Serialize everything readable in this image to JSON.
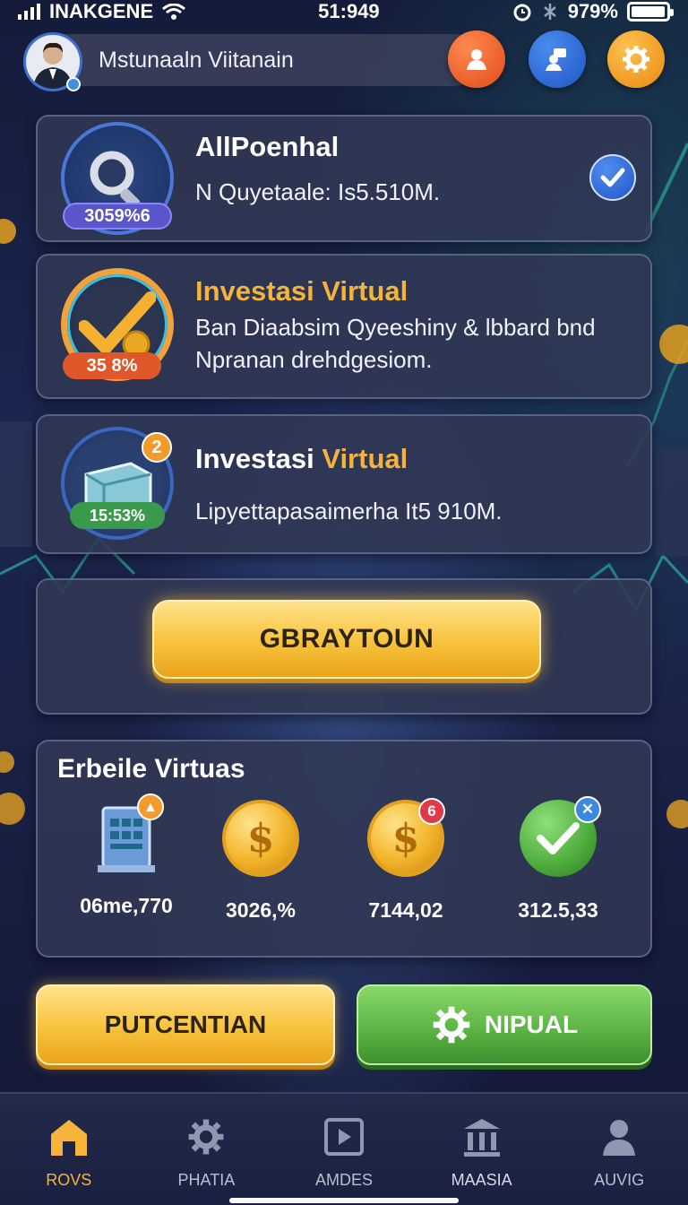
{
  "status_bar": {
    "carrier": "INAKGENE",
    "time": "51:949",
    "battery": "979%",
    "battery_level": 0.97
  },
  "header": {
    "user_name": "Mstunaaln Viitanain",
    "icons": [
      "profile-icon",
      "switch-account-icon",
      "gear-icon"
    ]
  },
  "cards": [
    {
      "title": "AllPoenhal",
      "percent": "3059%6",
      "description": "N Quyetaale: Is5.510M.",
      "icon": "magnifier-icon",
      "status_icon": "checkmark-icon"
    },
    {
      "title": "Investasi Virtual",
      "percent": "35 8%",
      "description": "Ban Diaabsim Qyeeshiny & lbbard bnd Npranan drehdgesiom.",
      "icon": "gold-checkmark-icon"
    },
    {
      "title_main": "Investasi",
      "title_accent": "Virtual",
      "percent": "15:53%",
      "badge": "2",
      "description": "Lipyettapasaimerha It5 910M.",
      "icon": "wallet-icon"
    }
  ],
  "main_action": {
    "label": "GBRAYTOUN"
  },
  "stats": {
    "title": "Erbeile Virtuas",
    "items": [
      {
        "value": "06me,770",
        "icon": "building-icon"
      },
      {
        "value": "3026,%",
        "icon": "dollar-coin-icon"
      },
      {
        "value": "7144,02",
        "icon": "dollar-coin-icon",
        "badge": "6"
      },
      {
        "value": "312.5,33",
        "icon": "green-check-icon"
      }
    ]
  },
  "actions": {
    "left_label": "PUTCENTIAN",
    "right_label": "NIPUAL"
  },
  "tabs": [
    {
      "label": "ROVS",
      "icon": "home-icon",
      "active": true
    },
    {
      "label": "PHATIA",
      "icon": "gear-icon"
    },
    {
      "label": "AMDES",
      "icon": "play-icon"
    },
    {
      "label": "MAASIA",
      "icon": "bank-icon"
    },
    {
      "label": "AUVIG",
      "icon": "person-icon"
    }
  ],
  "colors": {
    "accent_gold": "#f4b43c",
    "accent_green": "#5cb544",
    "accent_blue": "#2356c8",
    "background": "#1b2550"
  }
}
